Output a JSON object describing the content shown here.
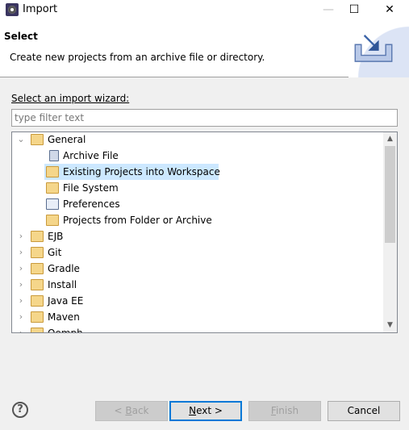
{
  "window": {
    "title": "Import",
    "minimize": "—",
    "maximize": "☐",
    "close": "✕"
  },
  "header": {
    "title": "Select",
    "description": "Create new projects from an archive file or directory."
  },
  "wizard": {
    "label": "Select an import wizard:",
    "filter_placeholder": "type filter text",
    "filter_value": ""
  },
  "tree": [
    {
      "label": "General",
      "level": 0,
      "expanded": true,
      "icon": "folder-open-icon"
    },
    {
      "label": "Archive File",
      "level": 1,
      "icon": "archive-file-icon"
    },
    {
      "label": "Existing Projects into Workspace",
      "level": 1,
      "icon": "project-folder-icon",
      "selected": true
    },
    {
      "label": "File System",
      "level": 1,
      "icon": "folder-icon"
    },
    {
      "label": "Preferences",
      "level": 1,
      "icon": "preferences-icon"
    },
    {
      "label": "Projects from Folder or Archive",
      "level": 1,
      "icon": "folder-icon"
    },
    {
      "label": "EJB",
      "level": 0,
      "expanded": false,
      "icon": "folder-open-icon"
    },
    {
      "label": "Git",
      "level": 0,
      "expanded": false,
      "icon": "folder-open-icon"
    },
    {
      "label": "Gradle",
      "level": 0,
      "expanded": false,
      "icon": "folder-open-icon"
    },
    {
      "label": "Install",
      "level": 0,
      "expanded": false,
      "icon": "folder-open-icon"
    },
    {
      "label": "Java EE",
      "level": 0,
      "expanded": false,
      "icon": "folder-open-icon"
    },
    {
      "label": "Maven",
      "level": 0,
      "expanded": false,
      "icon": "folder-open-icon"
    },
    {
      "label": "Oomph",
      "level": 0,
      "expanded": false,
      "icon": "folder-open-icon"
    }
  ],
  "buttons": {
    "help": "?",
    "back": {
      "pre": "< ",
      "key": "B",
      "rest": "ack"
    },
    "next": {
      "key": "N",
      "rest": "ext >"
    },
    "finish": {
      "key": "F",
      "rest": "inish"
    },
    "cancel": "Cancel"
  },
  "colors": {
    "selection": "#cce8ff",
    "default_button_border": "#0078d7"
  }
}
